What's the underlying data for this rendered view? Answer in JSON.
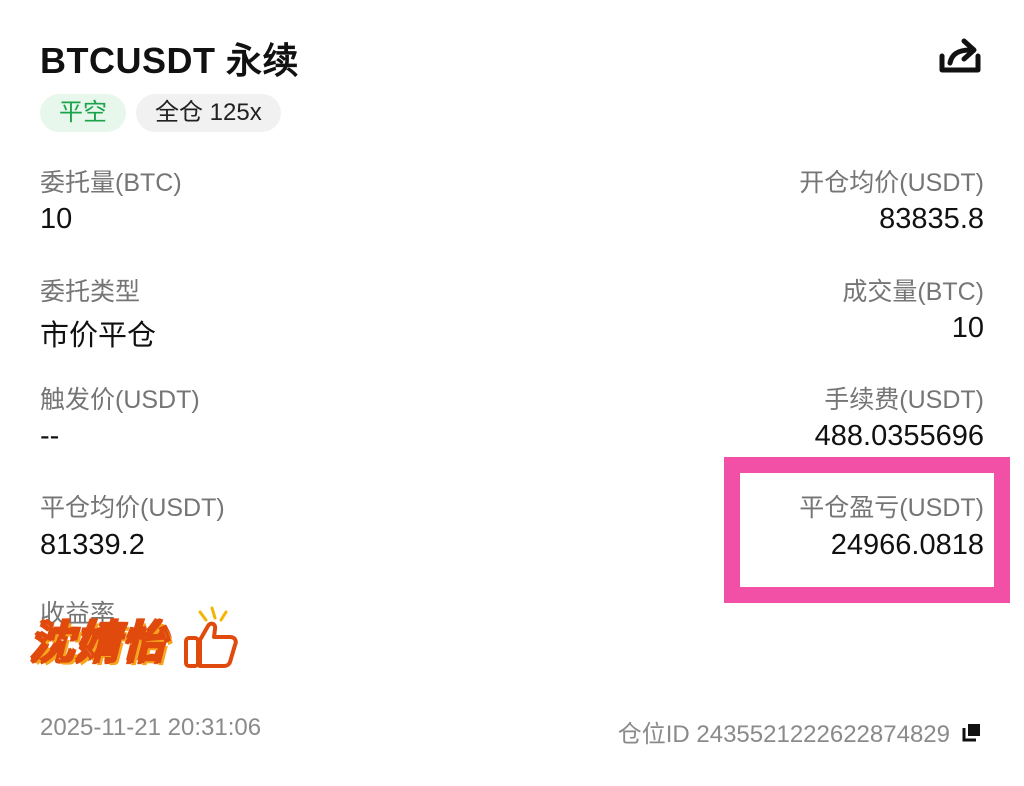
{
  "header": {
    "title": "BTCUSDT 永续",
    "share_icon": "share-icon",
    "tags": [
      "平空",
      "全仓 125x"
    ]
  },
  "fields": {
    "order_qty": {
      "label": "委托量(BTC)",
      "value": "10"
    },
    "open_avg_price": {
      "label": "开仓均价(USDT)",
      "value": "83835.8"
    },
    "order_type": {
      "label": "委托类型",
      "value": "市价平仓"
    },
    "filled_qty": {
      "label": "成交量(BTC)",
      "value": "10"
    },
    "trigger_price": {
      "label": "触发价(USDT)",
      "value": "--"
    },
    "fee": {
      "label": "手续费(USDT)",
      "value": "488.0355696"
    },
    "close_avg_price": {
      "label": "平仓均价(USDT)",
      "value": "81339.2"
    },
    "close_pnl": {
      "label": "平仓盈亏(USDT)",
      "value": "24966.0818"
    },
    "yield_rate": {
      "label": "收益率"
    }
  },
  "watermark": {
    "text": "沈婧怡"
  },
  "footer": {
    "timestamp": "2025-11-21 20:31:06",
    "position_id": "仓位ID 2435521222622874829",
    "copy_icon": "copy-icon"
  },
  "colors": {
    "tag_green_bg": "#e8f7ec",
    "tag_green_text": "#1aa34a",
    "highlight_border": "#f24fa7"
  }
}
